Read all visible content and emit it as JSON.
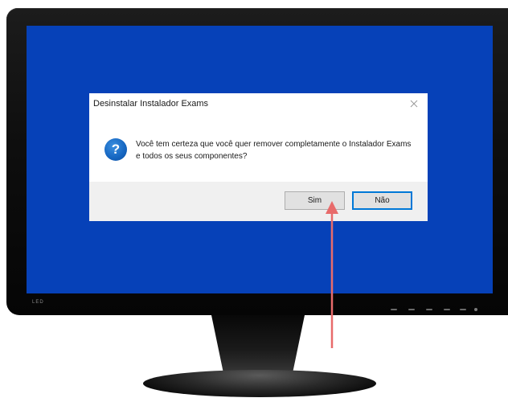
{
  "dialog": {
    "title": "Desinstalar Instalador Exams",
    "message": "Você tem certeza que você quer remover completamente o Instalador Exams e todos os seus componentes?",
    "icon": "question-icon",
    "close_icon": "close-icon",
    "buttons": {
      "yes_label": "Sim",
      "no_label": "Não"
    }
  },
  "monitor": {
    "brand": "LED"
  },
  "colors": {
    "screen_background": "#0641b8",
    "dialog_footer": "#f0f0f0",
    "primary_button_border": "#0078d7",
    "annotation_arrow": "#e86b6b"
  }
}
